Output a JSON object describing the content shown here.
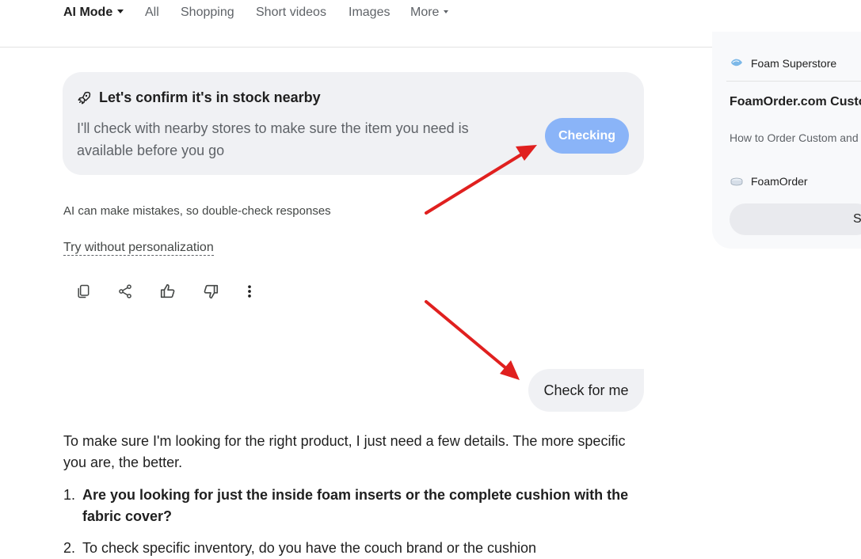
{
  "nav": {
    "items": [
      {
        "label": "AI Mode",
        "active": true
      },
      {
        "label": "All"
      },
      {
        "label": "Shopping"
      },
      {
        "label": "Short videos"
      },
      {
        "label": "Images"
      },
      {
        "label": "More"
      }
    ]
  },
  "stock_card": {
    "icon": "rocket-icon",
    "title": "Let's confirm it's in stock nearby",
    "description": "I'll check with nearby stores to make sure the item you need is available before you go",
    "button_label": "Checking",
    "button_color": "#8ab4f8"
  },
  "disclaimer": "AI can make mistakes, so double-check responses",
  "try_link": "Try without personalization",
  "actions": [
    "copy-icon",
    "share-icon",
    "thumbs-up-icon",
    "thumbs-down-icon",
    "more-vert-icon"
  ],
  "user_message": "Check for me",
  "answer": {
    "intro": "To make sure I'm looking for the right product, I just need a few details. The more specific you are, the better.",
    "questions": [
      {
        "num": "1.",
        "text": "Are you looking for just the inside foam inserts or the complete cushion with the fabric cover?"
      },
      {
        "num": "2.",
        "text": "To check specific inventory, do you have the couch brand or the cushion"
      }
    ]
  },
  "side_panel": {
    "source_top": "Foam Superstore",
    "title": "FoamOrder.com Custom Cushions & Mattresses",
    "snippet": "How to Order Custom and F Cushions Measure Your Cus",
    "source_bottom": "FoamOrder",
    "button_label": "S"
  },
  "annotation_color": "#e0201f"
}
